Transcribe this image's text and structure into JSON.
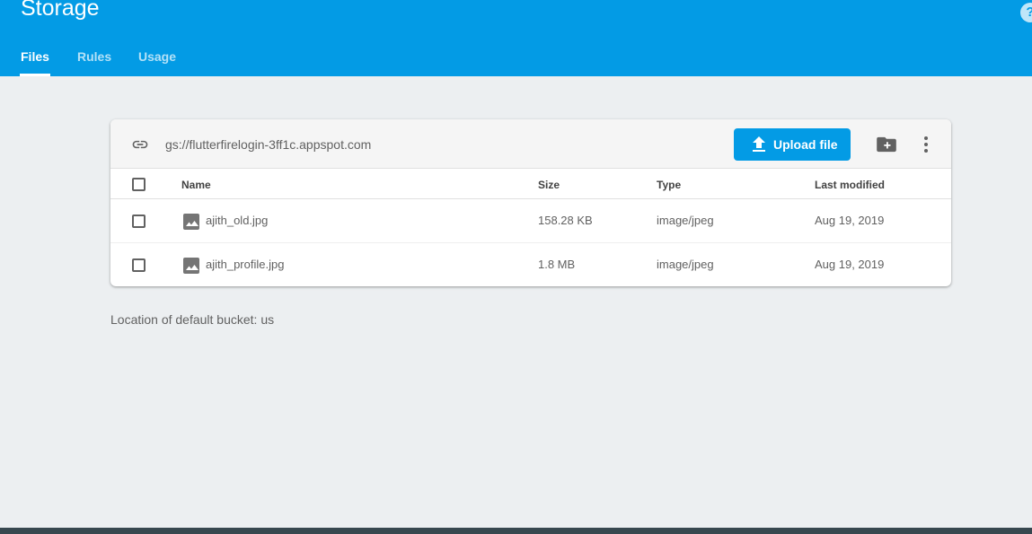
{
  "header": {
    "title": "Storage",
    "help_icon": "help-circle-icon",
    "tabs": [
      {
        "label": "Files",
        "active": true
      },
      {
        "label": "Rules",
        "active": false
      },
      {
        "label": "Usage",
        "active": false
      }
    ]
  },
  "toolbar": {
    "bucket_path": "gs://flutterfirelogin-3ff1c.appspot.com",
    "upload_label": "Upload file",
    "link_icon": "link-icon",
    "new_folder_icon": "create-new-folder-icon",
    "more_icon": "more-vert-icon"
  },
  "table": {
    "columns": [
      "Name",
      "Size",
      "Type",
      "Last modified"
    ],
    "rows": [
      {
        "name": "ajith_old.jpg",
        "size": "158.28 KB",
        "type": "image/jpeg",
        "modified": "Aug 19, 2019",
        "icon": "image-icon"
      },
      {
        "name": "ajith_profile.jpg",
        "size": "1.8 MB",
        "type": "image/jpeg",
        "modified": "Aug 19, 2019",
        "icon": "image-icon"
      }
    ]
  },
  "footer": {
    "bucket_location": "Location of default bucket: us"
  },
  "colors": {
    "header_bg": "#039be5",
    "page_bg": "#eceff1",
    "button_bg": "#039be5",
    "text_secondary": "#616161"
  }
}
